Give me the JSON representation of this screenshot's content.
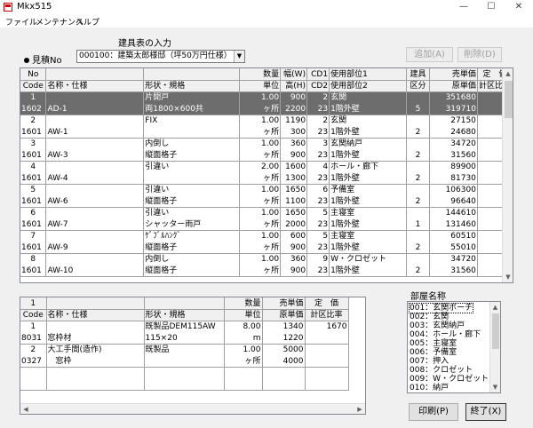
{
  "window": {
    "title": "Mkx515",
    "min": "—",
    "max": "☐",
    "close": "✕"
  },
  "menu": [
    "ファイル",
    "メンテナンス",
    "ヘルプ"
  ],
  "section_title": "建具表の入力",
  "mitsumori": {
    "label": "見積No",
    "value": "000100：建築太郎様邸（坪50万円仕様）"
  },
  "buttons": {
    "add": "追加(A)",
    "delete": "削除(D)",
    "print": "印刷(P)",
    "exit": "終了(X)"
  },
  "main_grid": {
    "headers": {
      "no": [
        "No",
        "Code"
      ],
      "name": [
        "",
        "名称・仕様"
      ],
      "shape": [
        "",
        "形状・規格"
      ],
      "qty": [
        "数量",
        "単位"
      ],
      "width": [
        "幅(W)",
        "高(H)"
      ],
      "cd": [
        "CD1",
        "CD2"
      ],
      "loc": [
        "使用部位1",
        "使用部位2"
      ],
      "kubun": [
        "建具",
        "区分"
      ],
      "price": [
        "売単価",
        "原単価"
      ],
      "rate": [
        "定　価",
        "計区比率"
      ]
    },
    "rows": [
      {
        "no": "1",
        "code": "1602",
        "name": "AD-1",
        "shape1": "片開戸",
        "shape2": "両1800×600共",
        "qty": "1.00",
        "unit": "ヶ所",
        "w": "900",
        "h": "2200",
        "cd1": "2",
        "cd2": "23",
        "loc1": "玄関",
        "loc2": "1階外壁",
        "kubun": "5",
        "price": "351680",
        "cost": "319710"
      },
      {
        "no": "2",
        "code": "1601",
        "name": "AW-1",
        "shape1": "FIX",
        "shape2": "",
        "qty": "1.00",
        "unit": "ヶ所",
        "w": "1190",
        "h": "300",
        "cd1": "2",
        "cd2": "23",
        "loc1": "玄関",
        "loc2": "1階外壁",
        "kubun": "2",
        "price": "27150",
        "cost": "24680"
      },
      {
        "no": "3",
        "code": "1601",
        "name": "AW-3",
        "shape1": "内倒し",
        "shape2": "縦面格子",
        "qty": "1.00",
        "unit": "ヶ所",
        "w": "360",
        "h": "900",
        "cd1": "3",
        "cd2": "23",
        "loc1": "玄関納戸",
        "loc2": "1階外壁",
        "kubun": "2",
        "price": "34720",
        "cost": "31560"
      },
      {
        "no": "4",
        "code": "1601",
        "name": "AW-4",
        "shape1": "引違い",
        "shape2": "",
        "qty": "2.00",
        "unit": "ヶ所",
        "w": "1600",
        "h": "1300",
        "cd1": "4",
        "cd2": "23",
        "loc1": "ホール・廊下",
        "loc2": "1階外壁",
        "kubun": "2",
        "price": "89900",
        "cost": "81730"
      },
      {
        "no": "5",
        "code": "1601",
        "name": "AW-6",
        "shape1": "引違い",
        "shape2": "縦面格子",
        "qty": "1.00",
        "unit": "ヶ所",
        "w": "1650",
        "h": "1100",
        "cd1": "6",
        "cd2": "23",
        "loc1": "予備室",
        "loc2": "1階外壁",
        "kubun": "2",
        "price": "106300",
        "cost": "96640"
      },
      {
        "no": "6",
        "code": "1601",
        "name": "AW-7",
        "shape1": "引違い",
        "shape2": "シャッター雨戸",
        "qty": "1.00",
        "unit": "ヶ所",
        "w": "1650",
        "h": "2000",
        "cd1": "5",
        "cd2": "23",
        "loc1": "主寝室",
        "loc2": "1階外壁",
        "kubun": "1",
        "price": "144610",
        "cost": "131460"
      },
      {
        "no": "7",
        "code": "1601",
        "name": "AW-9",
        "shape1": "ｹﾞﾌﾞﾙﾊﾝｸﾞ",
        "shape2": "縦面格子",
        "qty": "1.00",
        "unit": "ヶ所",
        "w": "600",
        "h": "900",
        "cd1": "5",
        "cd2": "23",
        "loc1": "主寝室",
        "loc2": "1階外壁",
        "kubun": "2",
        "price": "60510",
        "cost": "55010"
      },
      {
        "no": "8",
        "code": "1601",
        "name": "AW-10",
        "shape1": "内倒し",
        "shape2": "縦面格子",
        "qty": "1.00",
        "unit": "ヶ所",
        "w": "360",
        "h": "900",
        "cd1": "9",
        "cd2": "23",
        "loc1": "W・クロゼット",
        "loc2": "1階外壁",
        "kubun": "2",
        "price": "34720",
        "cost": "31560"
      }
    ]
  },
  "sub_grid": {
    "headers": {
      "no": [
        "1",
        "Code"
      ],
      "name": [
        "",
        "名称・仕様"
      ],
      "shape": [
        "",
        "形状・規格"
      ],
      "qty": [
        "数量",
        "単位"
      ],
      "price": [
        "売単価",
        "原単価"
      ],
      "rate": [
        "定　価",
        "計区比率"
      ]
    },
    "rows": [
      {
        "no": "1",
        "code": "8031",
        "name1": "",
        "name2": "窓枠材",
        "shape1": "既製品DEM115AW",
        "shape2": "115×20",
        "qty": "8.00",
        "unit": "m",
        "price": "1340",
        "cost": "1220",
        "rate": "1670"
      },
      {
        "no": "2",
        "code": "0327",
        "name1": "大工手間(造作)",
        "name2": "　窓枠",
        "shape1": "既製品",
        "shape2": "",
        "qty": "1.00",
        "unit": "ヶ所",
        "price": "5000",
        "cost": "4000",
        "rate": ""
      }
    ]
  },
  "room": {
    "label": "部屋名称",
    "items": [
      "001：玄関ポーチ",
      "002：玄関",
      "003：玄関納戸",
      "004：ホール・廊下",
      "005：主寝室",
      "006：予備室",
      "007：押入",
      "008：クロゼット",
      "009：W・クロゼット",
      "010：納戸"
    ]
  }
}
